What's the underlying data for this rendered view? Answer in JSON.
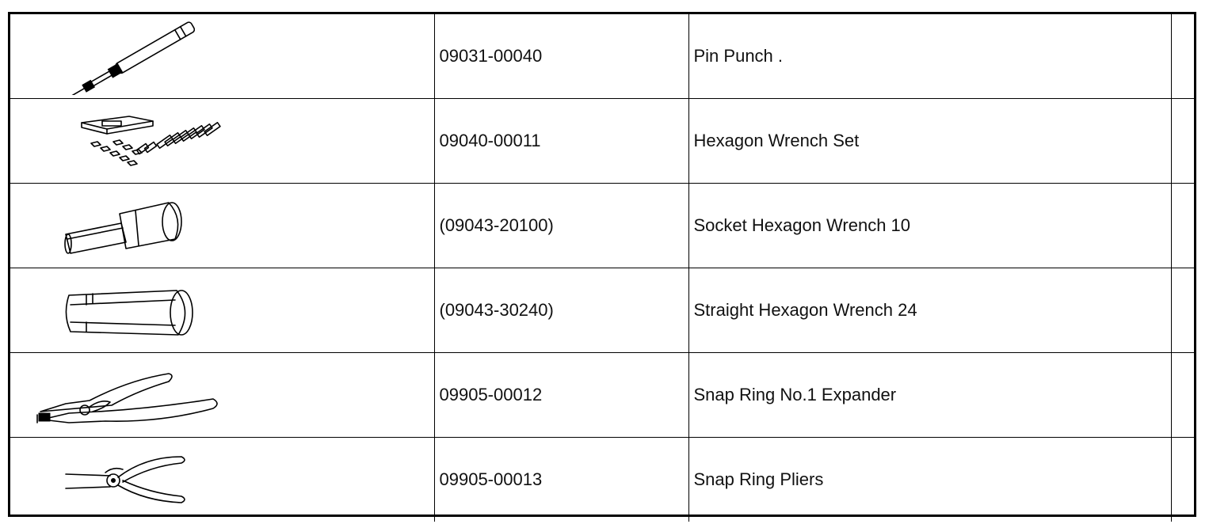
{
  "tools": [
    {
      "number": "09031-00040",
      "name": "Pin Punch .",
      "icon": "pin-punch-icon"
    },
    {
      "number": "09040-00011",
      "name": "Hexagon Wrench Set",
      "icon": "hexagon-wrench-set-icon"
    },
    {
      "number": "(09043-20100)",
      "name": "Socket Hexagon Wrench 10",
      "icon": "socket-hexagon-wrench-icon"
    },
    {
      "number": "(09043-30240)",
      "name": "Straight Hexagon Wrench 24",
      "icon": "straight-hexagon-wrench-icon"
    },
    {
      "number": "09905-00012",
      "name": "Snap Ring No.1 Expander",
      "icon": "snap-ring-expander-icon"
    },
    {
      "number": "09905-00013",
      "name": "Snap Ring Pliers",
      "icon": "snap-ring-pliers-icon"
    }
  ]
}
